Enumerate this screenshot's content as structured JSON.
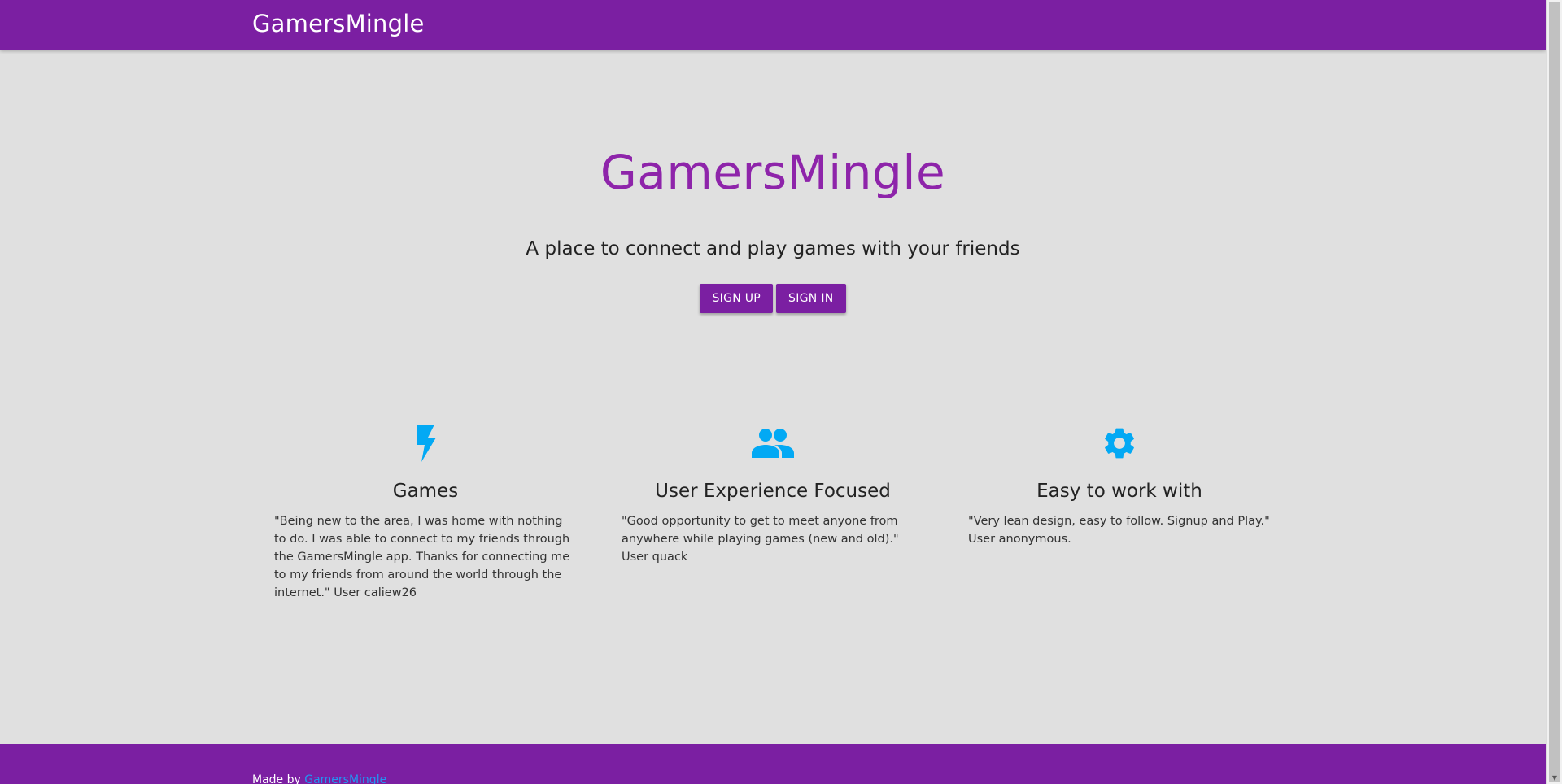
{
  "navbar": {
    "brand": "GamersMingle"
  },
  "hero": {
    "title": "GamersMingle",
    "subtitle": "A place to connect and play games with your friends",
    "buttons": {
      "sign_up": "SIGN UP",
      "sign_in": "SIGN IN"
    }
  },
  "features": [
    {
      "icon": "bolt-icon",
      "title": "Games",
      "text": "\"Being new to the area, I was home with nothing to do. I was able to connect to my friends through the GamersMingle app. Thanks for connecting me to my friends from around the world through the internet.\" User caliew26"
    },
    {
      "icon": "people-icon",
      "title": "User Experience Focused",
      "text": "\"Good opportunity to get to meet anyone from anywhere while playing games (new and old).\" User quack"
    },
    {
      "icon": "gear-icon",
      "title": "Easy to work with",
      "text": "\"Very lean design, easy to follow. Signup and Play.\" User anonymous."
    }
  ],
  "footer": {
    "prefix": "Made by ",
    "link": "GamersMingle"
  },
  "colors": {
    "primary": "#7b1fa2",
    "title": "#8e24aa",
    "icon": "#03a9f4",
    "background": "#e0e0e0",
    "link": "#2196f3"
  }
}
